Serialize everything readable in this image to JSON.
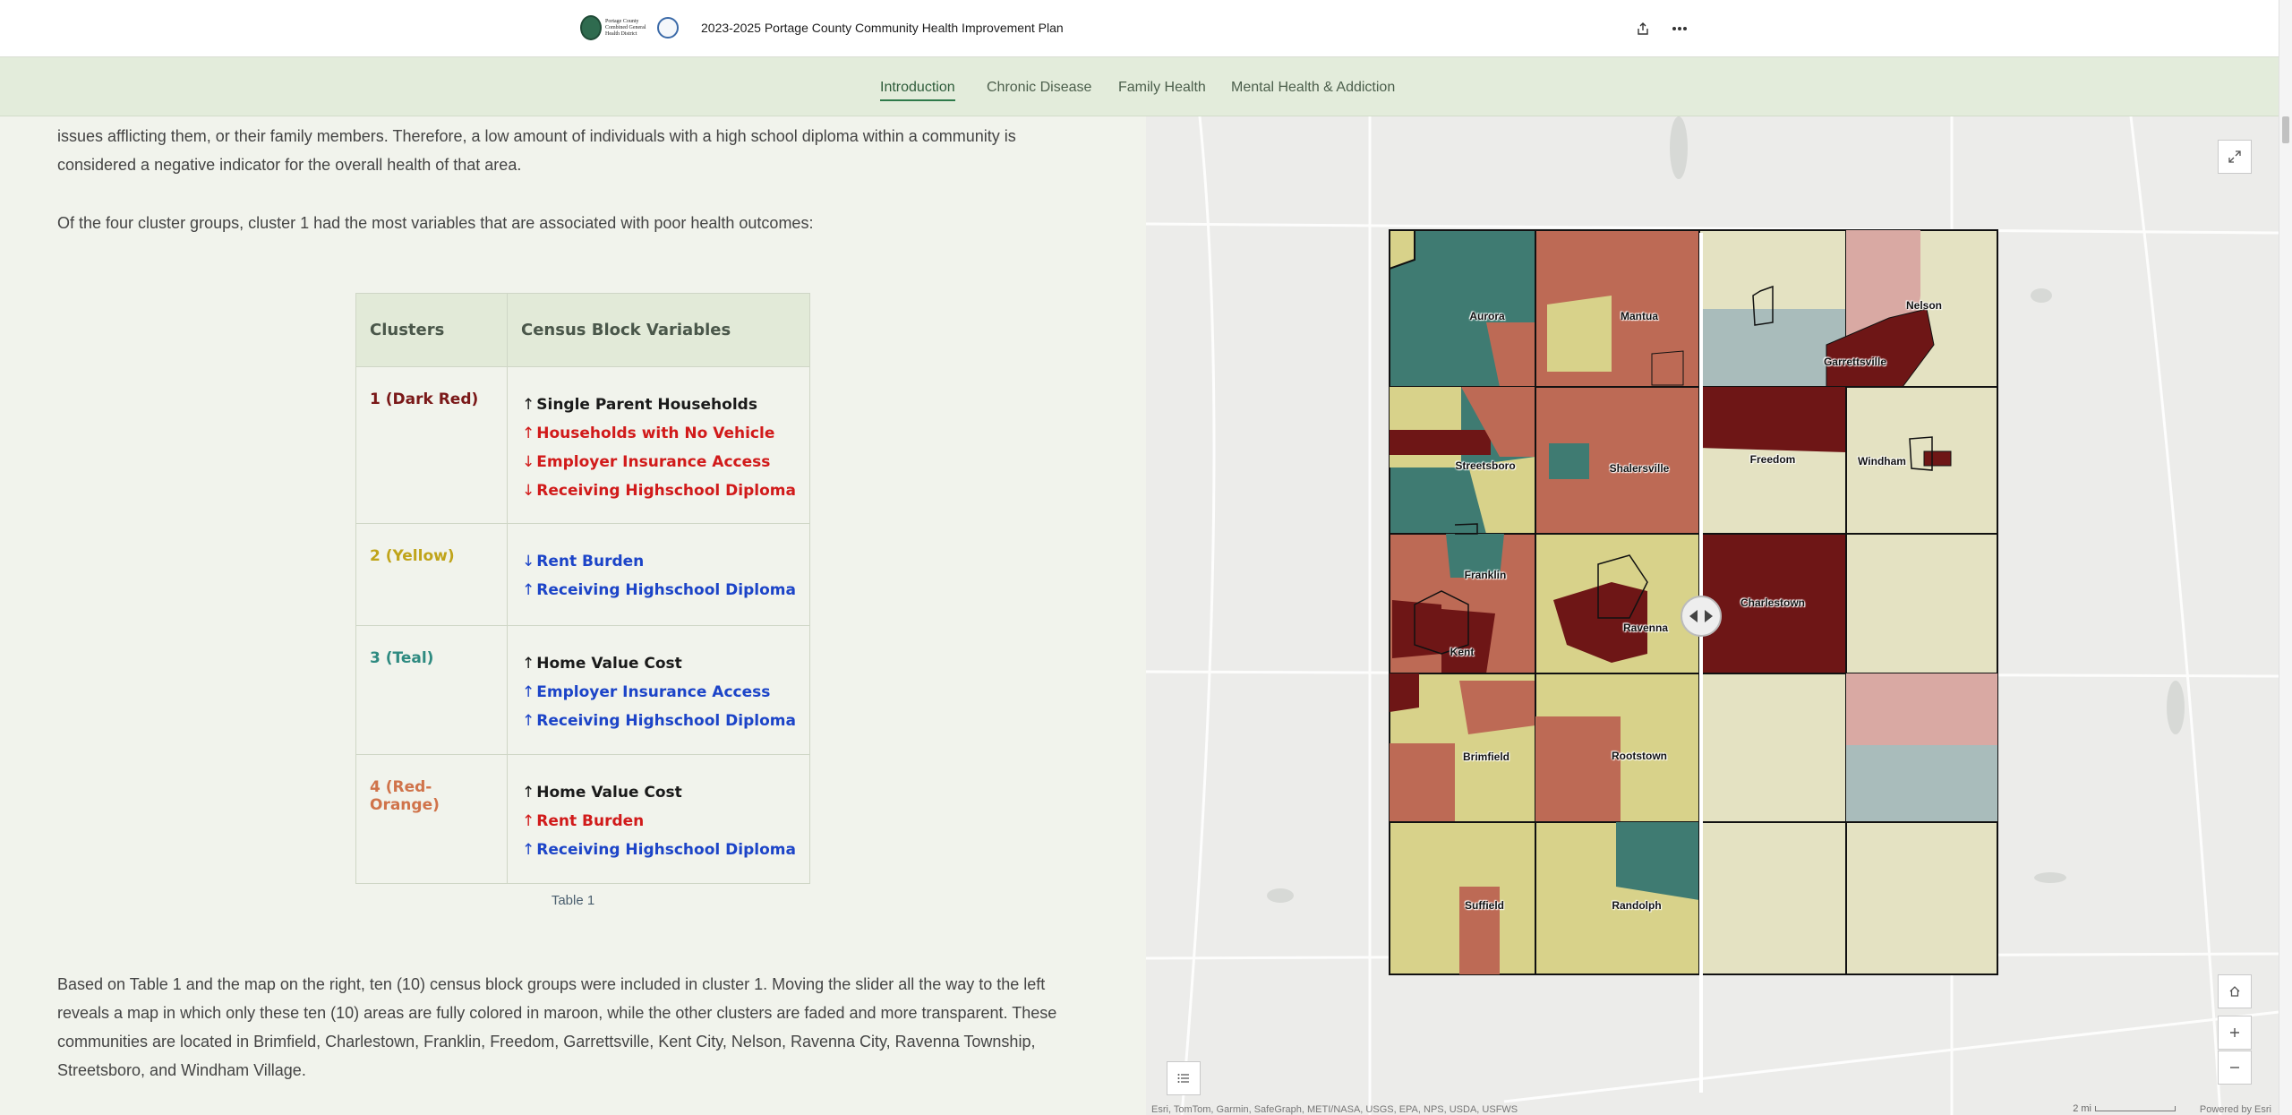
{
  "header": {
    "logo_text": "Portage County Combined General Health District",
    "title": "2023-2025 Portage County Community Health Improvement Plan",
    "share_label": "share",
    "more_label": "more options"
  },
  "nav": {
    "items": [
      {
        "label": "Introduction",
        "active": true
      },
      {
        "label": "Chronic Disease",
        "active": false
      },
      {
        "label": "Family Health",
        "active": false
      },
      {
        "label": "Mental Health & Addiction",
        "active": false
      }
    ]
  },
  "content": {
    "para_top": "issues afflicting them, or their family members. Therefore, a low amount of individuals with a high school diploma within a community is considered a negative indicator for the overall health of that area.",
    "para_clusters": "Of the four cluster groups, cluster 1 had the most variables that are associated with poor health outcomes:",
    "table": {
      "headers": [
        "Clusters",
        "Census Block Variables"
      ],
      "rows": [
        {
          "cluster": "1 (Dark Red)",
          "color": "#7a1818",
          "vars": [
            {
              "arrow": "↑",
              "text": "Single Parent Households",
              "color": "#1a1a1a"
            },
            {
              "arrow": "↑",
              "text": "Households with No Vehicle",
              "color": "#d11a1a"
            },
            {
              "arrow": "↓",
              "text": "Employer Insurance Access",
              "color": "#d11a1a"
            },
            {
              "arrow": "↓",
              "text": "Receiving Highschool Diploma",
              "color": "#d11a1a"
            }
          ]
        },
        {
          "cluster": "2 (Yellow)",
          "color": "#c0a41a",
          "vars": [
            {
              "arrow": "↓",
              "text": "Rent Burden",
              "color": "#1c44c8"
            },
            {
              "arrow": "↑",
              "text": "Receiving Highschool Diploma",
              "color": "#1c44c8"
            }
          ]
        },
        {
          "cluster": "3 (Teal)",
          "color": "#2e8a80",
          "vars": [
            {
              "arrow": "↑",
              "text": "Home Value Cost",
              "color": "#1a1a1a"
            },
            {
              "arrow": "↑",
              "text": "Employer Insurance Access",
              "color": "#1c44c8"
            },
            {
              "arrow": "↑",
              "text": "Receiving Highschool Diploma",
              "color": "#1c44c8"
            }
          ]
        },
        {
          "cluster": "4 (Red-Orange)",
          "color": "#d0734a",
          "vars": [
            {
              "arrow": "↑",
              "text": "Home Value Cost",
              "color": "#1a1a1a"
            },
            {
              "arrow": "↑",
              "text": "Rent Burden",
              "color": "#d11a1a"
            },
            {
              "arrow": "↑",
              "text": "Receiving Highschool Diploma",
              "color": "#1c44c8"
            }
          ]
        }
      ],
      "caption": "Table 1"
    },
    "para_bottom": "Based on Table 1 and the map on the right, ten (10) census block groups were included in cluster 1. Moving the slider all the way to the left reveals a map in which only these ten (10) areas are fully colored in maroon, while the other clusters are faded and more transparent. These communities are located in Brimfield, Charlestown, Franklin, Freedom, Garrettsville, Kent City, Nelson, Ravenna City, Ravenna Township, Streetsboro, and Windham Village."
  },
  "map": {
    "places": [
      "Aurora",
      "Mantua",
      "Nelson",
      "Garrettsville",
      "Streetsboro",
      "Shalersville",
      "Freedom",
      "Windham",
      "Franklin",
      "Charlestown",
      "Ravenna",
      "Kent",
      "Brimfield",
      "Rootstown",
      "Suffield",
      "Randolph"
    ],
    "attribution": "Esri, TomTom, Garmin, SafeGraph, METI/NASA, USGS, EPA, NPS, USDA, USFWS",
    "scale": "2 mi",
    "powered_by": "Powered by Esri",
    "colors": {
      "dark_red": "#6e1616",
      "yellow": "#d8d28a",
      "teal": "#3f7b72",
      "red_orange": "#bd6a55"
    }
  }
}
